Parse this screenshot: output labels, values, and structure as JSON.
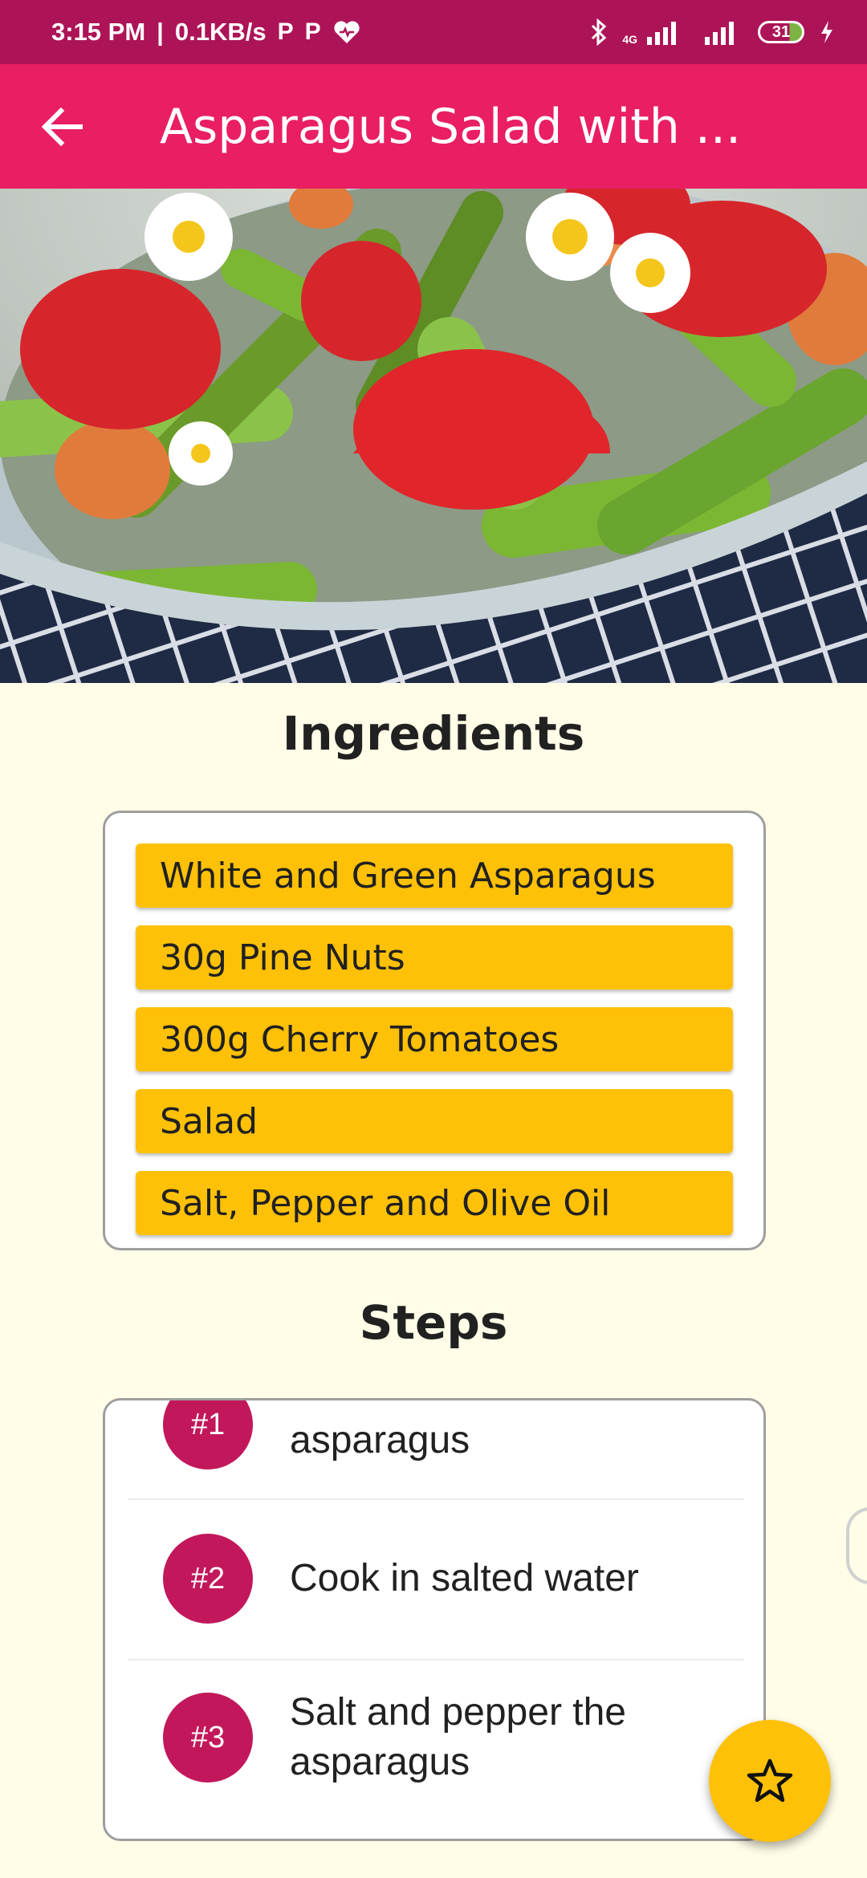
{
  "status_bar": {
    "time": "3:15 PM",
    "speed": "0.1KB/s",
    "notif_icons": [
      "parking-icon",
      "parking-icon",
      "heart-icon"
    ],
    "network_type": "4G",
    "battery": "31"
  },
  "app_bar": {
    "title": "Asparagus Salad with ..."
  },
  "ingredients": {
    "heading": "Ingredients",
    "items": [
      "White and Green Asparagus",
      "30g Pine Nuts",
      "300g Cherry Tomatoes",
      "Salad",
      "Salt, Pepper and Olive Oil"
    ]
  },
  "steps": {
    "heading": "Steps",
    "items": [
      {
        "num": "#1",
        "text": "asparagus"
      },
      {
        "num": "#2",
        "text": "Cook in salted water"
      },
      {
        "num": "#3",
        "text": "Salt and pepper the asparagus"
      }
    ]
  },
  "colors": {
    "status_bar": "#ad1457",
    "app_bar": "#e91e63",
    "background": "#fffde7",
    "ingredient_chip": "#ffc107",
    "step_badge": "#c2185b",
    "fab": "#ffc107"
  },
  "icons": {
    "back": "arrow-back-icon",
    "fab": "star-outline-icon"
  }
}
